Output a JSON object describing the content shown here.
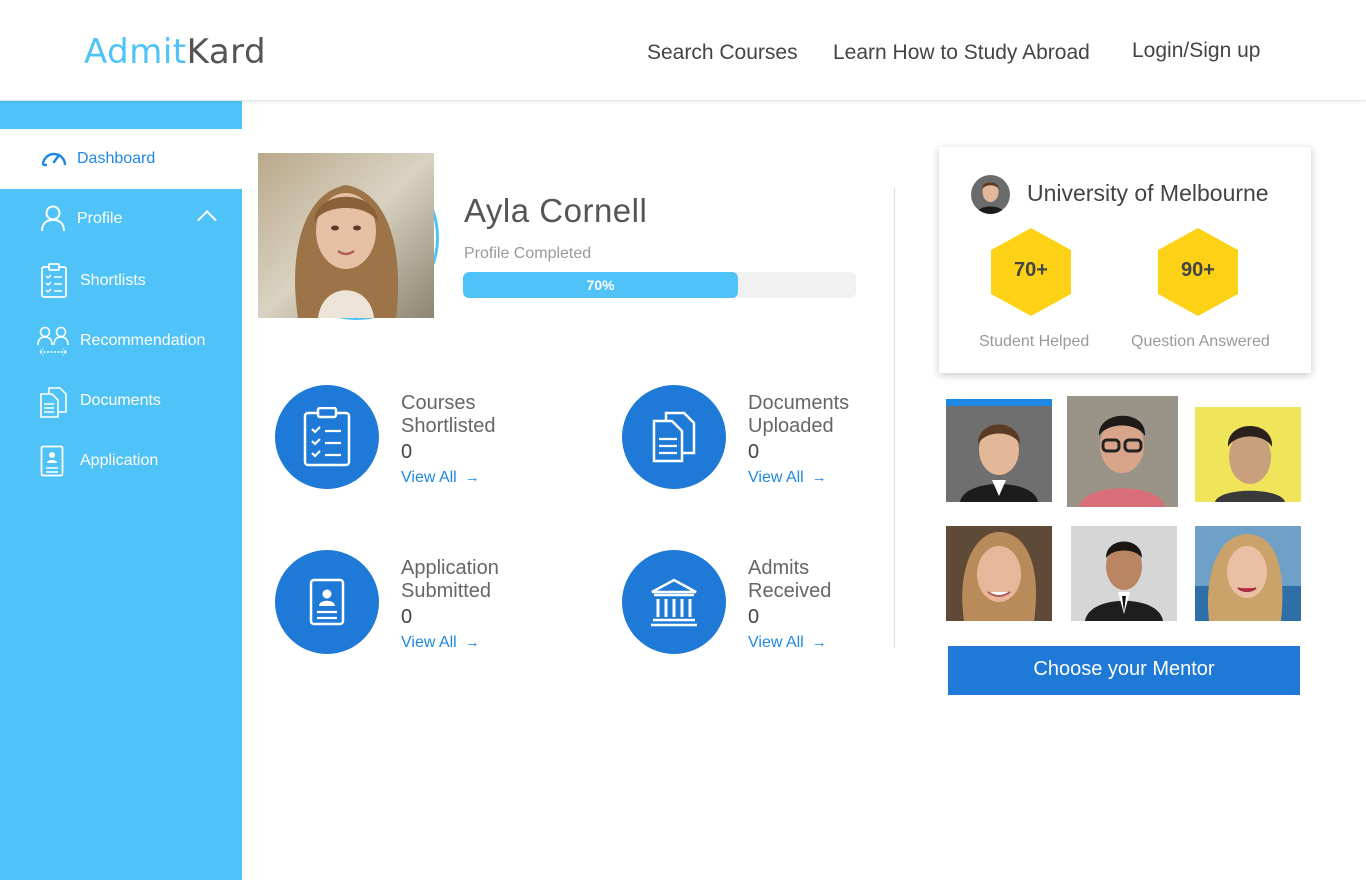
{
  "header": {
    "logo_part1": "Admit",
    "logo_part2": "Kard",
    "nav": {
      "search_courses": "Search Courses",
      "learn_study_abroad": "Learn How to Study Abroad",
      "login_signup": "Login/Sign up"
    }
  },
  "sidebar": {
    "items": [
      {
        "label": "Dashboard",
        "icon": "speedometer-icon"
      },
      {
        "label": "Profile",
        "icon": "user-icon"
      },
      {
        "label": "Shortlists",
        "icon": "clipboard-list-icon"
      },
      {
        "label": "Recommendation",
        "icon": "people-exchange-icon"
      },
      {
        "label": "Documents",
        "icon": "documents-icon"
      },
      {
        "label": "Application",
        "icon": "application-form-icon"
      }
    ]
  },
  "profile": {
    "name": "Ayla Cornell",
    "completed_label": "Profile Completed",
    "progress_text": "70%",
    "progress_fraction": 0.7
  },
  "stats": [
    {
      "title_line1": "Courses",
      "title_line2": "Shortlisted",
      "value": "0",
      "link": "View All",
      "icon": "checklist-icon"
    },
    {
      "title_line1": "Documents",
      "title_line2": "Uploaded",
      "value": "0",
      "link": "View All",
      "icon": "documents-icon"
    },
    {
      "title_line1": "Application",
      "title_line2": "Submitted",
      "value": "0",
      "link": "View All",
      "icon": "id-card-icon"
    },
    {
      "title_line1": "Admits",
      "title_line2": "Received",
      "value": "0",
      "link": "View All",
      "icon": "university-building-icon"
    }
  ],
  "mentor_card": {
    "university": "University of Melbourne",
    "students_helped_value": "70+",
    "students_helped_label": "Student Helped",
    "questions_answered_value": "90+",
    "questions_answered_label": "Question Answered"
  },
  "choose_mentor_button": "Choose your Mentor",
  "colors": {
    "sidebar": "#4fc3f7",
    "primary_blue": "#1e7ad6",
    "link_blue": "#1e88e5",
    "hexagon": "#fcd116"
  }
}
